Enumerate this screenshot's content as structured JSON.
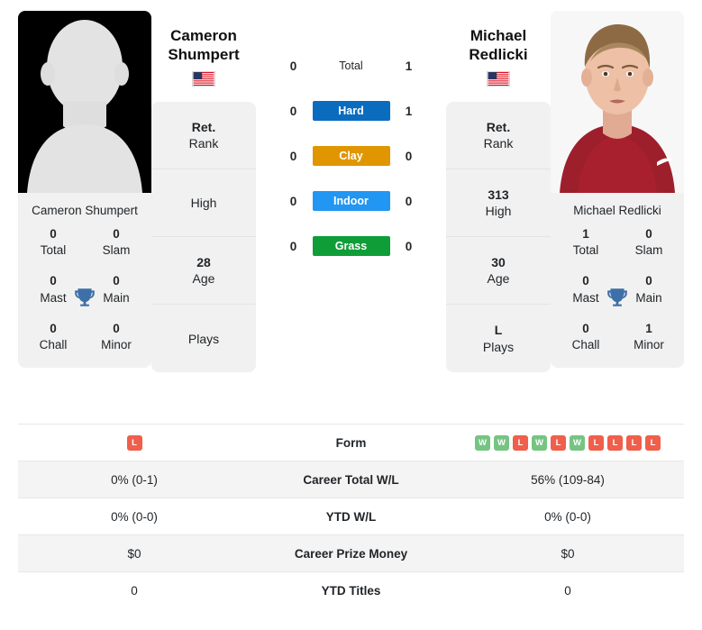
{
  "players": {
    "left": {
      "first_name": "Cameron",
      "last_name": "Shumpert",
      "full_name": "Cameron Shumpert",
      "country": "USA",
      "flag_icon": "flag-usa-icon",
      "photo_kind": "avatar-placeholder",
      "titles": [
        {
          "value": "0",
          "label": "Total"
        },
        {
          "value": "0",
          "label": "Slam"
        },
        {
          "value": "0",
          "label": "Mast"
        },
        {
          "value": "0",
          "label": "Main"
        },
        {
          "value": "0",
          "label": "Chall"
        },
        {
          "value": "0",
          "label": "Minor"
        }
      ],
      "info": [
        {
          "value": "Ret.",
          "label": "Rank"
        },
        {
          "value": "",
          "label": "High"
        },
        {
          "value": "28",
          "label": "Age"
        },
        {
          "value": "",
          "label": "Plays"
        }
      ]
    },
    "right": {
      "first_name": "Michael",
      "last_name": "Redlicki",
      "full_name": "Michael Redlicki",
      "country": "USA",
      "flag_icon": "flag-usa-icon",
      "photo_kind": "player-portrait",
      "titles": [
        {
          "value": "1",
          "label": "Total"
        },
        {
          "value": "0",
          "label": "Slam"
        },
        {
          "value": "0",
          "label": "Mast"
        },
        {
          "value": "0",
          "label": "Main"
        },
        {
          "value": "0",
          "label": "Chall"
        },
        {
          "value": "1",
          "label": "Minor"
        }
      ],
      "info": [
        {
          "value": "Ret.",
          "label": "Rank"
        },
        {
          "value": "313",
          "label": "High"
        },
        {
          "value": "30",
          "label": "Age"
        },
        {
          "value": "L",
          "label": "Plays"
        }
      ]
    }
  },
  "head_to_head": [
    {
      "label": "Total",
      "left": "0",
      "right": "1",
      "style": "plain",
      "color": ""
    },
    {
      "label": "Hard",
      "left": "0",
      "right": "1",
      "style": "chip",
      "color": "#0a6cbf"
    },
    {
      "label": "Clay",
      "left": "0",
      "right": "0",
      "style": "chip",
      "color": "#e09600"
    },
    {
      "label": "Indoor",
      "left": "0",
      "right": "0",
      "style": "chip",
      "color": "#2196f3"
    },
    {
      "label": "Grass",
      "left": "0",
      "right": "0",
      "style": "chip",
      "color": "#0f9d38"
    }
  ],
  "colors": {
    "win_badge": "#76c482",
    "loss_badge": "#ef5f4b",
    "trophy": "#3e6fa8",
    "card_bg": "#f1f1f1",
    "alt_row": "#f4f4f4"
  },
  "stats_rows": [
    {
      "label": "Form",
      "type": "form",
      "left_form": [
        "L"
      ],
      "right_form": [
        "W",
        "W",
        "L",
        "W",
        "L",
        "W",
        "L",
        "L",
        "L",
        "L"
      ],
      "alt": false
    },
    {
      "label": "Career Total W/L",
      "type": "text",
      "left": "0% (0-1)",
      "right": "56% (109-84)",
      "alt": true
    },
    {
      "label": "YTD W/L",
      "type": "text",
      "left": "0% (0-0)",
      "right": "0% (0-0)",
      "alt": false
    },
    {
      "label": "Career Prize Money",
      "type": "text",
      "left": "$0",
      "right": "$0",
      "alt": true
    },
    {
      "label": "YTD Titles",
      "type": "text",
      "left": "0",
      "right": "0",
      "alt": false
    }
  ]
}
